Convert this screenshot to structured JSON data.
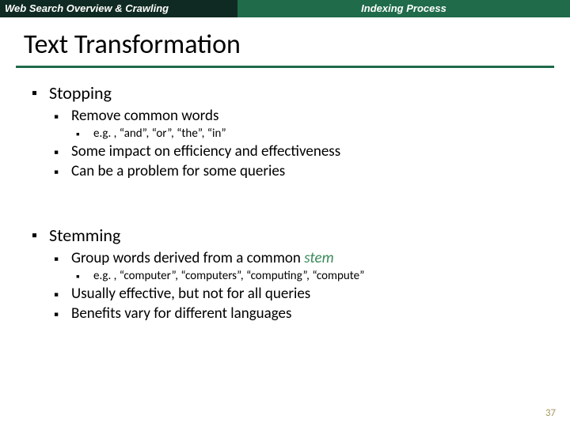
{
  "header": {
    "left": "Web Search Overview & Crawling",
    "right": "Indexing Process"
  },
  "title": "Text Transformation",
  "sections": [
    {
      "heading": "Stopping",
      "items": [
        {
          "text": "Remove common words",
          "sub": "e.g. , “and”, “or”, “the”, “in”"
        },
        {
          "text": "Some impact on efficiency and effectiveness"
        },
        {
          "text": "Can be a problem for some queries"
        }
      ]
    },
    {
      "heading": "Stemming",
      "items": [
        {
          "text_prefix": "Group words derived from a common ",
          "stem_word": "stem",
          "sub": "e.g. , “computer”, “computers”, “computing”, “compute”"
        },
        {
          "text": "Usually effective, but not for all queries"
        },
        {
          "text": "Benefits vary for different languages"
        }
      ]
    }
  ],
  "page_number": "37"
}
